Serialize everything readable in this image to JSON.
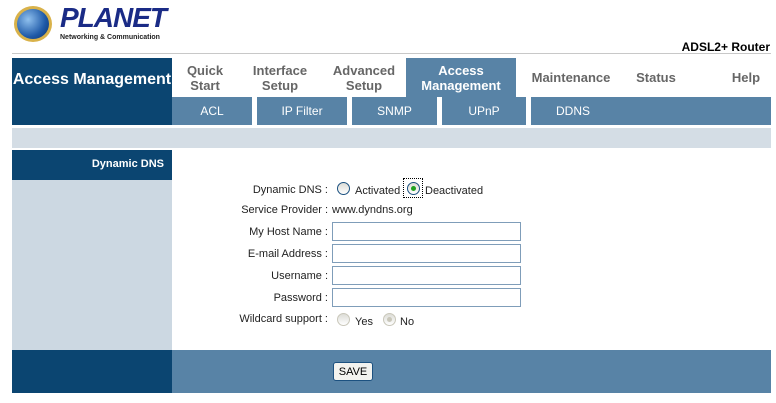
{
  "header": {
    "brand": "PLANET",
    "tagline": "Networking & Communication",
    "model": "ADSL2+ Router"
  },
  "section_title": "Access Management",
  "tabs": [
    {
      "label": "Quick Start"
    },
    {
      "label": "Interface Setup"
    },
    {
      "label": "Advanced Setup"
    },
    {
      "label": "Access Management"
    },
    {
      "label": "Maintenance"
    },
    {
      "label": "Status"
    },
    {
      "label": "Help"
    }
  ],
  "subtabs": [
    {
      "label": "ACL"
    },
    {
      "label": "IP Filter"
    },
    {
      "label": "SNMP"
    },
    {
      "label": "UPnP"
    },
    {
      "label": "DDNS"
    }
  ],
  "left_heading": "Dynamic DNS",
  "form": {
    "ddns_label": "Dynamic DNS :",
    "activated": "Activated",
    "deactivated": "Deactivated",
    "ddns_selected": "Deactivated",
    "provider_label": "Service Provider :",
    "provider_value": "www.dyndns.org",
    "host_label": "My Host Name :",
    "host_value": "",
    "email_label": "E-mail Address :",
    "email_value": "",
    "user_label": "Username :",
    "user_value": "",
    "pass_label": "Password :",
    "pass_value": "",
    "wildcard_label": "Wildcard support :",
    "yes": "Yes",
    "no": "No",
    "wildcard_selected": "No"
  },
  "save_label": "SAVE"
}
